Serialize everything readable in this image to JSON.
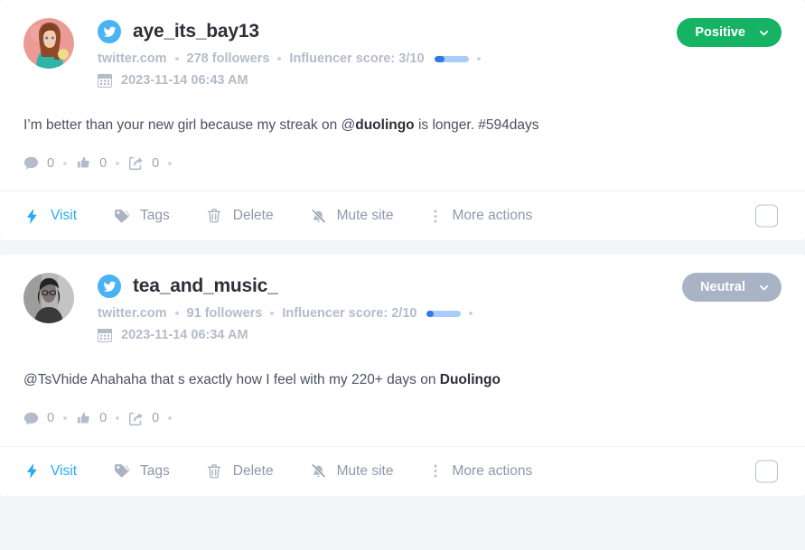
{
  "theme": {
    "page_bg": "#f4f5f7",
    "card_bg": "#ffffff",
    "accent_blue": "#29a9f3",
    "positive_green": "#16b364",
    "neutral_grey": "#a8b3c5",
    "meta_grey": "#b4bcc9",
    "score_fill": "#2c7be5",
    "score_track": "#a8cdf8"
  },
  "posts": [
    {
      "avatar": "illustrated-woman-avatar",
      "network_icon": "twitter-icon",
      "username": "aye_its_bay13",
      "source": "twitter.com",
      "followers": "278 followers",
      "influencer_score_label": "Influencer score: 3/10",
      "influencer_score_percent": 30,
      "date_icon": "calendar-icon",
      "date": "2023-11-14 06:43 AM",
      "sentiment": "Positive",
      "sentiment_kind": "positive",
      "text_parts": [
        {
          "t": "I’m better than your new girl because my streak on @",
          "b": false
        },
        {
          "t": "duolingo",
          "b": true
        },
        {
          "t": " is longer. #594days",
          "b": false
        }
      ],
      "stats": {
        "comments_icon": "comment-icon",
        "comments": "0",
        "likes_icon": "thumbs-up-icon",
        "likes": "0",
        "shares_icon": "share-icon",
        "shares": "0"
      },
      "actions": [
        {
          "icon": "lightning-icon",
          "label": "Visit",
          "kind": "visit"
        },
        {
          "icon": "tag-icon",
          "label": "Tags",
          "kind": "tags"
        },
        {
          "icon": "trash-icon",
          "label": "Delete",
          "kind": "delete"
        },
        {
          "icon": "bell-muted-icon",
          "label": "Mute site",
          "kind": "mute"
        },
        {
          "icon": "vertical-dots-icon",
          "label": "More actions",
          "kind": "more"
        }
      ]
    },
    {
      "avatar": "grayscale-photo-avatar",
      "network_icon": "twitter-icon",
      "username": "tea_and_music_",
      "source": "twitter.com",
      "followers": "91 followers",
      "influencer_score_label": "Influencer score: 2/10",
      "influencer_score_percent": 20,
      "date_icon": "calendar-icon",
      "date": "2023-11-14 06:34 AM",
      "sentiment": "Neutral",
      "sentiment_kind": "neutral",
      "text_parts": [
        {
          "t": "@TsVhide Ahahaha that s exactly how I feel with my 220+ days on ",
          "b": false
        },
        {
          "t": "Duolingo",
          "b": true
        }
      ],
      "stats": {
        "comments_icon": "comment-icon",
        "comments": "0",
        "likes_icon": "thumbs-up-icon",
        "likes": "0",
        "shares_icon": "share-icon",
        "shares": "0"
      },
      "actions": [
        {
          "icon": "lightning-icon",
          "label": "Visit",
          "kind": "visit"
        },
        {
          "icon": "tag-icon",
          "label": "Tags",
          "kind": "tags"
        },
        {
          "icon": "trash-icon",
          "label": "Delete",
          "kind": "delete"
        },
        {
          "icon": "bell-muted-icon",
          "label": "Mute site",
          "kind": "mute"
        },
        {
          "icon": "vertical-dots-icon",
          "label": "More actions",
          "kind": "more"
        }
      ]
    }
  ]
}
